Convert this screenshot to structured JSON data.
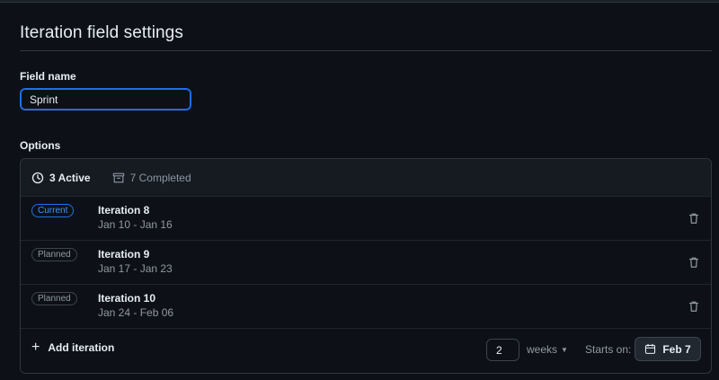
{
  "page": {
    "title": "Iteration field settings"
  },
  "field": {
    "label": "Field name",
    "value": "Sprint"
  },
  "options": {
    "label": "Options",
    "tabs": [
      {
        "label": "3 Active",
        "icon": "clock-icon"
      },
      {
        "label": "7 Completed",
        "icon": "archive-icon"
      }
    ],
    "iterations": [
      {
        "status": "Current",
        "name": "Iteration 8",
        "dates": "Jan 10 - Jan 16"
      },
      {
        "status": "Planned",
        "name": "Iteration 9",
        "dates": "Jan 17 - Jan 23"
      },
      {
        "status": "Planned",
        "name": "Iteration 10",
        "dates": "Jan 24 - Feb 06"
      }
    ],
    "footer": {
      "add_label": "Add iteration",
      "duration_value": "2",
      "duration_unit": "weeks",
      "starts_on_label": "Starts on:",
      "start_date": "Feb 7"
    }
  },
  "colors": {
    "background": "#0d1117",
    "accent": "#1f6feb",
    "current_badge": "#4493f8",
    "muted_text": "#9198a1"
  }
}
